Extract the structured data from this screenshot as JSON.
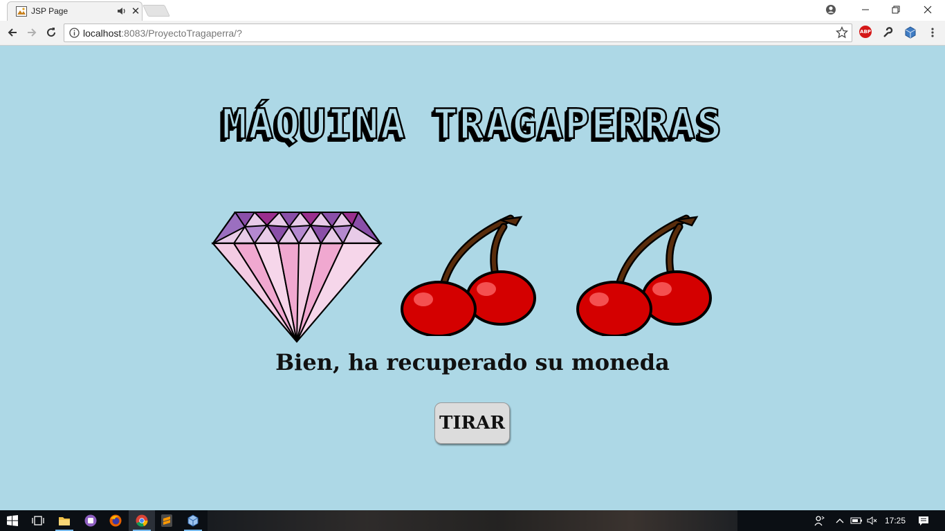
{
  "browser": {
    "tab_title": "JSP Page",
    "tab_close": "✕",
    "url_host": "localhost",
    "url_rest": ":8083/ProyectoTragaperra/?"
  },
  "page": {
    "heading": "MÁQUINA TRAGAPERRAS",
    "reels": [
      "diamond",
      "cherries",
      "cherries"
    ],
    "message": "Bien, ha recuperado su moneda",
    "spin_button": "TIRAR"
  },
  "taskbar": {
    "pinned": [
      "windows-start-icon",
      "task-view-icon",
      "file-explorer-icon",
      "app-icon",
      "firefox-icon",
      "chrome-icon",
      "sublime-icon",
      "virtualbox-icon"
    ],
    "clock": "17:25"
  },
  "colors": {
    "page_background": "#add8e6",
    "button_background": "#dcdcdc",
    "cherry_red": "#d40000",
    "diamond_pink": "#f0a8d0",
    "diamond_purple": "#8a4fa8"
  }
}
